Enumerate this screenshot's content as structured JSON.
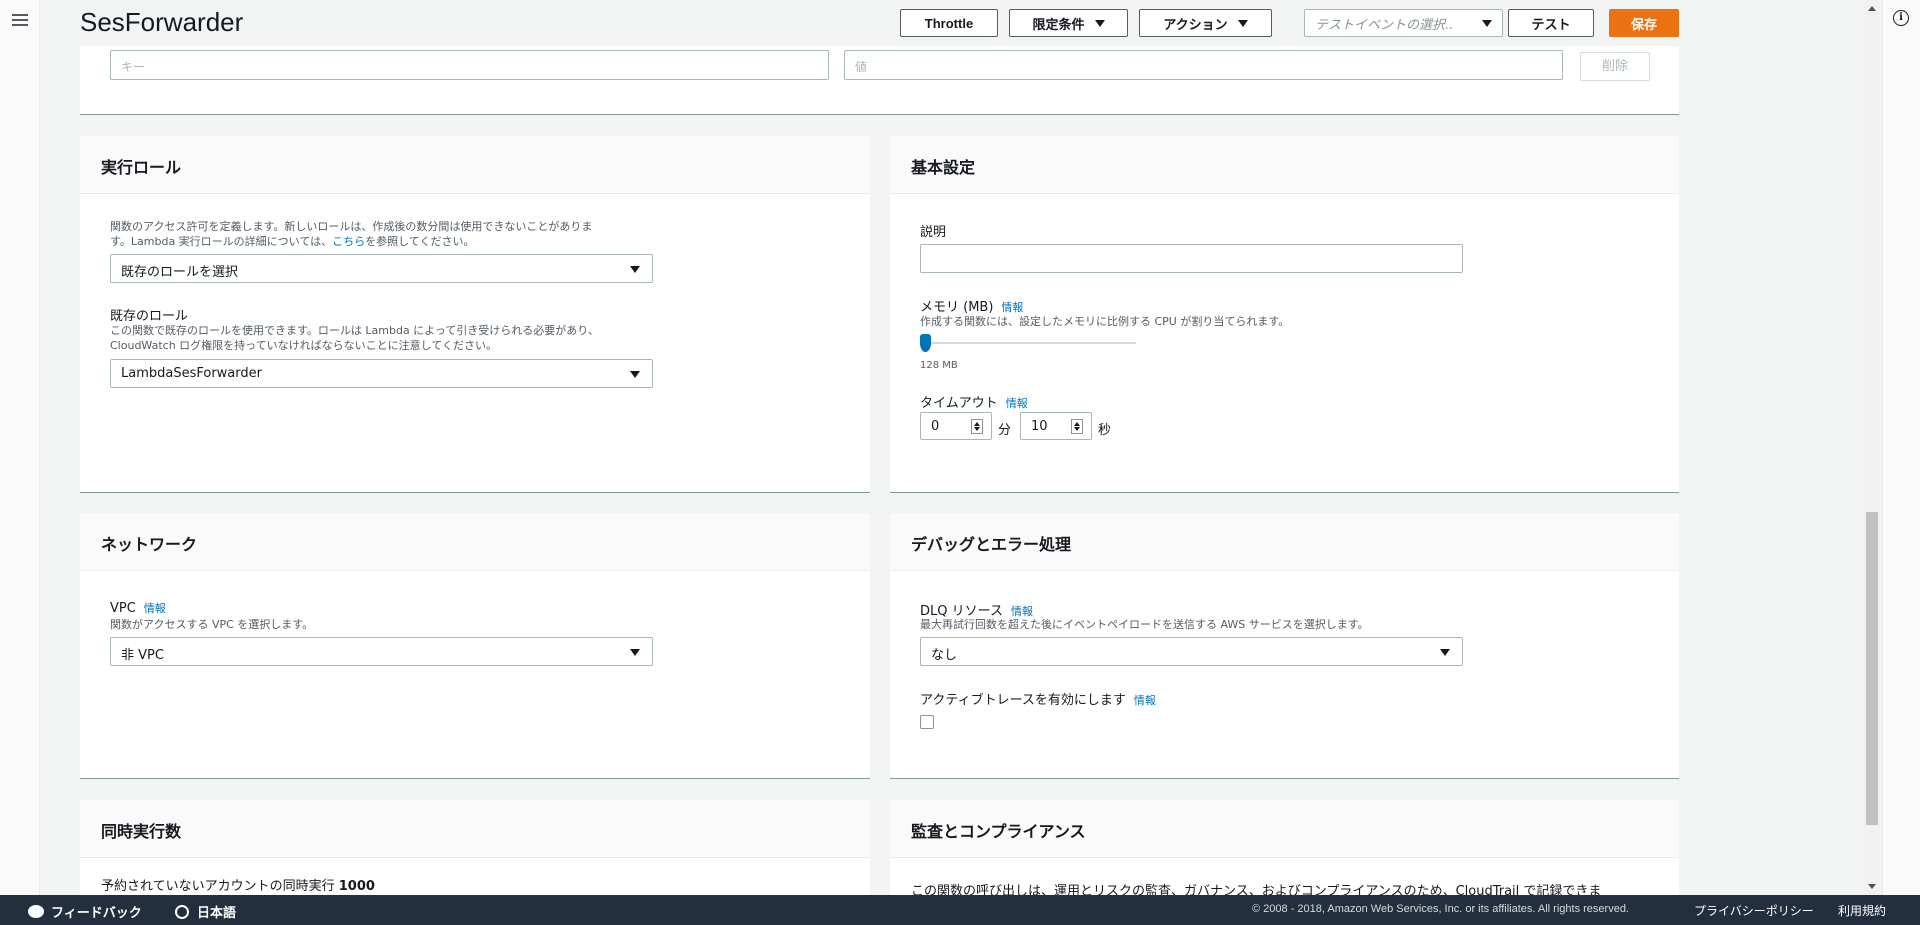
{
  "header": {
    "title": "SesForwarder",
    "throttle": "Throttle",
    "qualifiers": "限定条件",
    "actions": "アクション",
    "test_event_placeholder": "テストイベントの選択..",
    "test": "テスト",
    "save": "保存"
  },
  "env": {
    "key_placeholder": "キー",
    "value_placeholder": "値",
    "delete": "削除"
  },
  "role": {
    "heading": "実行ロール",
    "help_line1": "関数のアクセス許可を定義します。新しいロールは、作成後の数分間は使用できないことがありま",
    "help_line2_pre": "す。Lambda 実行ロールの詳細については、",
    "help_link": "こちら",
    "help_line2_post": "を参照してください。",
    "role_select": "既存のロールを選択",
    "existing_label": "既存のロール",
    "existing_help1": "この関数で既存のロールを使用できます。ロールは Lambda によって引き受けられる必要があり、",
    "existing_help2": "CloudWatch ログ権限を持っていなければならないことに注意してください。",
    "existing_value": "LambdaSesForwarder"
  },
  "basic": {
    "heading": "基本設定",
    "description_label": "説明",
    "memory_label": "メモリ (MB)",
    "info": "情報",
    "memory_help": "作成する関数には、設定したメモリに比例する CPU が割り当てられます。",
    "memory_value": "128 MB",
    "memory_fraction": 0.0,
    "timeout_label": "タイムアウト",
    "minutes": "0",
    "minutes_unit": "分",
    "seconds": "10",
    "seconds_unit": "秒"
  },
  "network": {
    "heading": "ネットワーク",
    "vpc_label": "VPC",
    "info": "情報",
    "vpc_help": "関数がアクセスする VPC を選択します。",
    "vpc_value": "非 VPC"
  },
  "debug": {
    "heading": "デバッグとエラー処理",
    "dlq_label": "DLQ リソース",
    "info": "情報",
    "dlq_help": "最大再試行回数を超えた後にイベントペイロードを送信する AWS サービスを選択します。",
    "dlq_value": "なし",
    "tracing_label": "アクティブトレースを有効にします",
    "tracing_info": "情報"
  },
  "concurrency": {
    "heading": "同時実行数",
    "unreserved_label": "予約されていないアカウントの同時実行",
    "unreserved_value": "1000"
  },
  "audit": {
    "heading": "監査とコンプライアンス",
    "text": "この関数の呼び出しは、運用とリスクの監査、ガバナンス、およびコンプライアンスのため、CloudTrail で記録できま"
  },
  "footer": {
    "feedback": "フィードバック",
    "language": "日本語",
    "copyright": "© 2008 - 2018, Amazon Web Services, Inc. or its affiliates. All rights reserved.",
    "privacy": "プライバシーポリシー",
    "terms": "利用規約"
  }
}
